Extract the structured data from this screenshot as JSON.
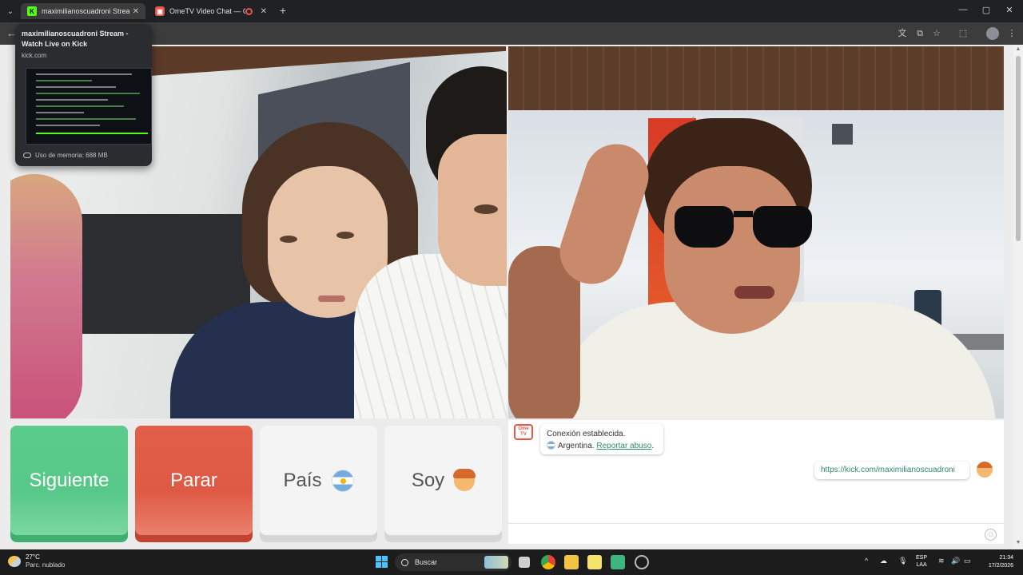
{
  "browser": {
    "tabs": [
      {
        "title": "maximilianoscuadroni Stream - Watch Live on Kick",
        "favicon": "K",
        "active": true
      },
      {
        "title": "OmeTV Video Chat — OmeTV",
        "favicon": "O",
        "active": false
      }
    ],
    "new_tab": "+",
    "window_controls": {
      "minimize": "—",
      "maximize": "▢",
      "close": "✕"
    }
  },
  "tooltip": {
    "title": "maximilianoscuadroni Stream - Watch Live on Kick",
    "domain": "kick.com",
    "memory": "Uso de memoria: 688 MB"
  },
  "controls": {
    "next": "Siguiente",
    "stop": "Parar",
    "country": "País",
    "gender": "Soy"
  },
  "chat": {
    "logo": "Ome TV",
    "system_line1": "Conexión establecida.",
    "system_country": "Argentina.",
    "report_link": "Reportar abuso",
    "report_suffix": ".",
    "my_message": "https://kick.com/maximilianoscuadroni",
    "smiley": "☺"
  },
  "taskbar": {
    "temperature": "27°C",
    "weather": "Parc. nublado",
    "search_placeholder": "Buscar",
    "lang_top": "ESP",
    "lang_bottom": "LAA",
    "time": "21:34",
    "date": "17/2/2026"
  },
  "colors": {
    "next_green": "#5ccc8c",
    "stop_red": "#e25f4a",
    "link_green": "#2e8b6e",
    "brand": "#e8574a"
  }
}
